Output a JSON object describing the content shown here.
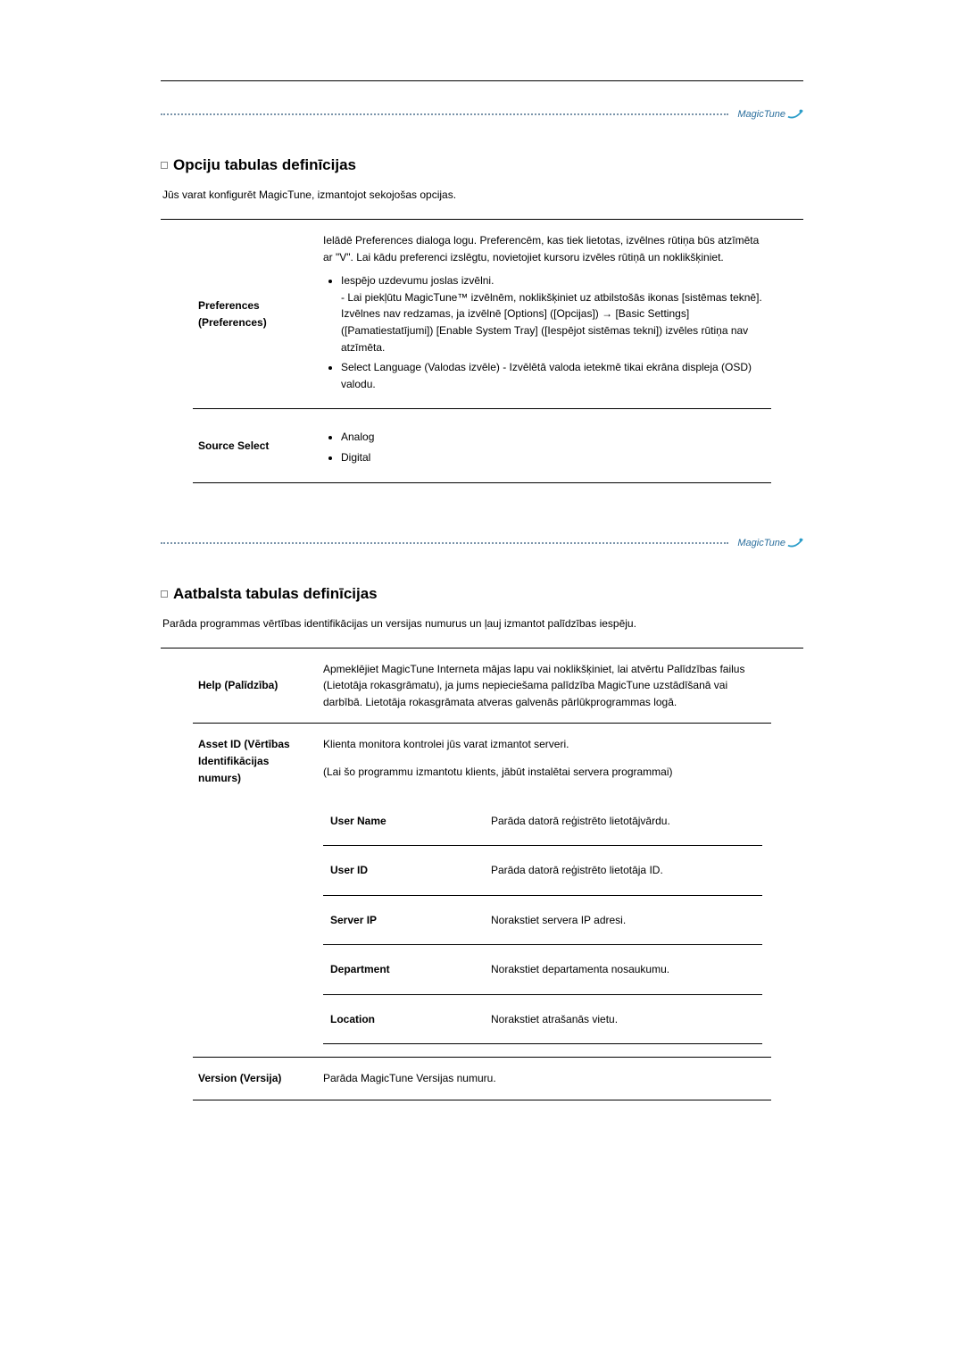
{
  "logo": "MagicTune",
  "section1": {
    "title": "Opciju tabulas definīcijas",
    "intro": "Jūs varat konfigurēt MagicTune, izmantojot sekojošas opcijas.",
    "rows": {
      "preferences": {
        "label": "Preferences (Preferences)",
        "lead": "Ielādē Preferences dialoga logu. Preferencēm, kas tiek lietotas, izvēlnes rūtiņa būs atzīmēta ar \"V\". Lai kādu preferenci izslēgtu, novietojiet kursoru izvēles rūtiņā un noklikšķiniet.",
        "b1a": "Iespējo uzdevumu joslas izvēlni.",
        "b1b": "- Lai piekļūtu MagicTune™ izvēlnēm, noklikšķiniet uz atbilstošās ikonas [sistēmas teknē].",
        "b1c": "Izvēlnes nav redzamas, ja izvēlnē [Options] ([Opcijas]) → [Basic Settings] ([Pamatiestatījumi]) [Enable System Tray] ([Iespējot sistēmas tekni]) izvēles rūtiņa nav atzīmēta.",
        "b2": "Select Language (Valodas izvēle) - Izvēlētā valoda ietekmē tikai ekrāna displeja (OSD) valodu."
      },
      "source": {
        "label": "Source Select",
        "opt1": "Analog",
        "opt2": "Digital"
      }
    }
  },
  "section2": {
    "title": "Aatbalsta tabulas definīcijas",
    "intro": "Parāda programmas vērtības identifikācijas un versijas numurus un ļauj izmantot palīdzības iespēju.",
    "help": {
      "label": "Help (Palīdzība)",
      "text": "Apmeklējiet MagicTune Interneta mājas lapu vai noklikšķiniet, lai atvērtu Palīdzības failus (Lietotāja rokasgrāmatu), ja jums nepieciešama palīdzība MagicTune uzstādīšanā vai darbībā. Lietotāja rokasgrāmata atveras galvenās pārlūkprogrammas logā."
    },
    "asset": {
      "label": "Asset ID (Vērtības Identifikācijas numurs)",
      "text1": "Klienta monitora kontrolei jūs varat izmantot serveri.",
      "text2": "(Lai šo programmu izmantotu klients, jābūt instalētai servera programmai)",
      "rows": {
        "r1k": "User Name",
        "r1v": "Parāda datorā reģistrēto lietotājvārdu.",
        "r2k": "User ID",
        "r2v": "Parāda datorā reģistrēto lietotāja ID.",
        "r3k": "Server IP",
        "r3v": "Norakstiet servera IP adresi.",
        "r4k": "Department",
        "r4v": "Norakstiet departamenta nosaukumu.",
        "r5k": "Location",
        "r5v": "Norakstiet atrašanās vietu."
      }
    },
    "version": {
      "label": "Version (Versija)",
      "text": "Parāda MagicTune Versijas numuru."
    }
  }
}
